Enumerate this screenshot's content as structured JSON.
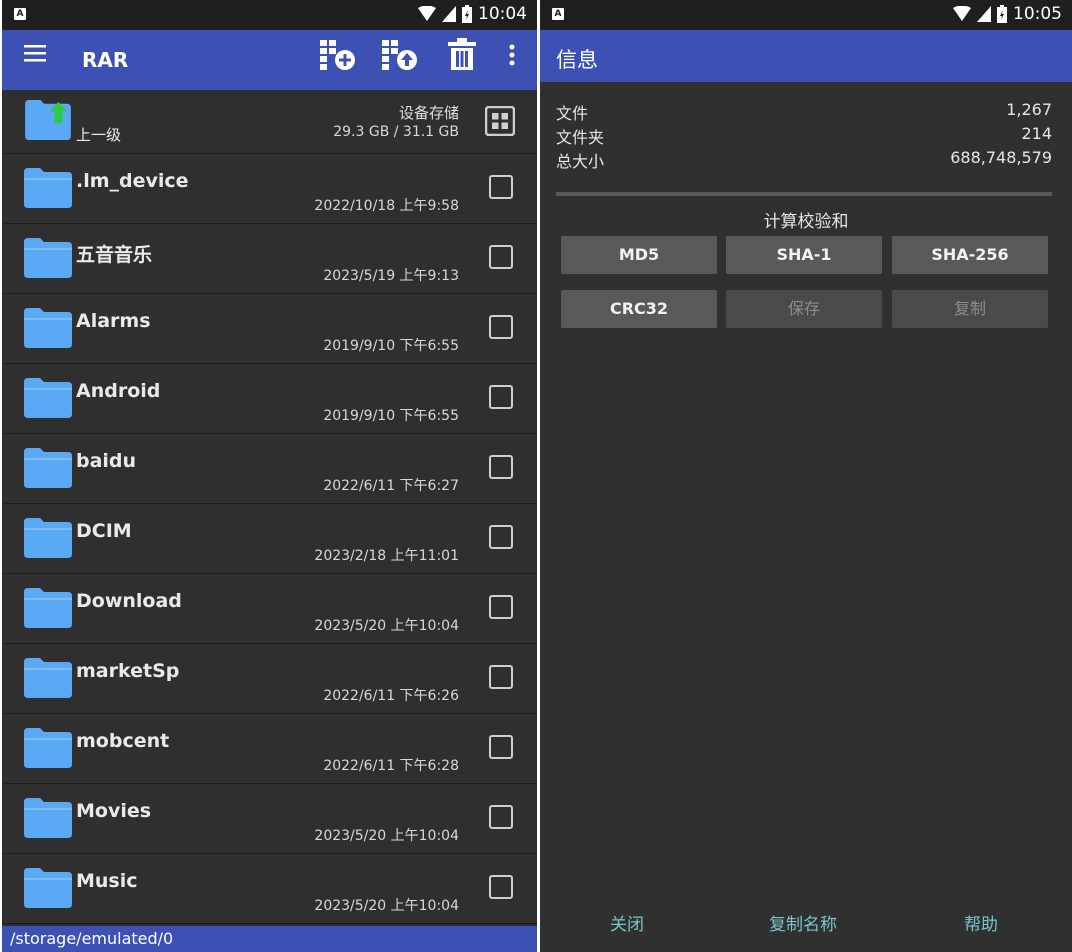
{
  "left": {
    "status_time": "10:04",
    "app_title": "RAR",
    "up_label": "上一级",
    "storage_label": "设备存储",
    "storage_size": "29.3 GB / 31.1 GB",
    "folders": [
      {
        "name": ".lm_device",
        "date": "2022/10/18 上午9:58"
      },
      {
        "name": "五音音乐",
        "date": "2023/5/19 上午9:13"
      },
      {
        "name": "Alarms",
        "date": "2019/9/10 下午6:55"
      },
      {
        "name": "Android",
        "date": "2019/9/10 下午6:55"
      },
      {
        "name": "baidu",
        "date": "2022/6/11 下午6:27"
      },
      {
        "name": "DCIM",
        "date": "2023/2/18 上午11:01"
      },
      {
        "name": "Download",
        "date": "2023/5/20 上午10:04"
      },
      {
        "name": "marketSp",
        "date": "2022/6/11 下午6:26"
      },
      {
        "name": "mobcent",
        "date": "2022/6/11 下午6:28"
      },
      {
        "name": "Movies",
        "date": "2023/5/20 上午10:04"
      },
      {
        "name": "Music",
        "date": "2023/5/20 上午10:04"
      }
    ],
    "path": "/storage/emulated/0"
  },
  "right": {
    "status_time": "10:05",
    "title": "信息",
    "files_label": "文件",
    "files_value": "1,267",
    "folders_label": "文件夹",
    "folders_value": "214",
    "size_label": "总大小",
    "size_value": "688,748,579",
    "checksum_title": "计算校验和",
    "buttons": {
      "md5": "MD5",
      "sha1": "SHA-1",
      "sha256": "SHA-256",
      "crc32": "CRC32",
      "save": "保存",
      "copy": "复制"
    },
    "footer": {
      "close": "关闭",
      "copy_name": "复制名称",
      "help": "帮助"
    }
  },
  "colors": {
    "appbar": "#3d51b5",
    "background": "#2f2f2f",
    "folder": "#5aa9f5",
    "accent": "#79c6c8",
    "up_arrow": "#2ecc40"
  }
}
